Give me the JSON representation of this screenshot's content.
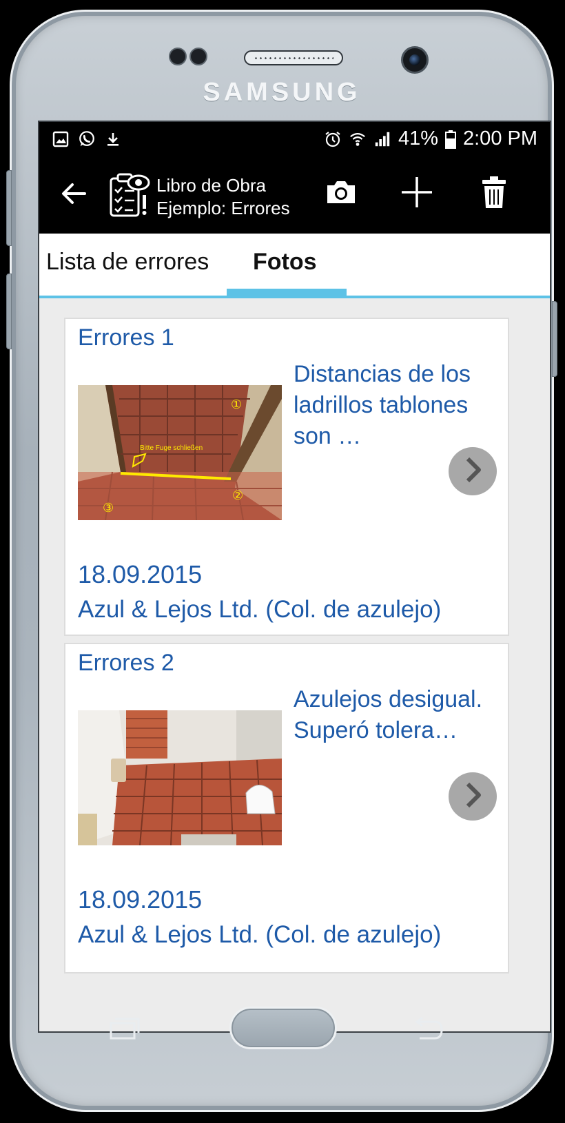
{
  "device": {
    "brand": "SAMSUNG"
  },
  "status_bar": {
    "left_icons": [
      "image-icon",
      "whatsapp-icon",
      "download-icon"
    ],
    "right_icons": [
      "alarm-icon",
      "wifi-icon",
      "signal-icon",
      "battery-icon"
    ],
    "battery": "41%",
    "time": "2:00 PM"
  },
  "app_bar": {
    "title_line1": "Libro de Obra",
    "title_line2": "Ejemplo: Errores",
    "actions": [
      "camera-icon",
      "add-icon",
      "trash-icon"
    ]
  },
  "tabs": [
    {
      "label": "Lista de errores",
      "active": false
    },
    {
      "label": "Fotos",
      "active": true
    }
  ],
  "accent": "#5dc2e6",
  "link_color": "#1e5aa8",
  "cards": [
    {
      "title": "Errores 1",
      "description": "Distancias de los ladrillos tablones son …",
      "image_annotation": "Bitte Fuge schließen",
      "image_markers": [
        "①",
        "②",
        "③"
      ],
      "date": "18.09.2015",
      "company": "Azul & Lejos Ltd. (Col. de azulejo)"
    },
    {
      "title": "Errores 2",
      "description": "Azulejos desigual. Superó tolera…",
      "date": "18.09.2015",
      "company": "Azul & Lejos Ltd. (Col. de azulejo)"
    }
  ]
}
